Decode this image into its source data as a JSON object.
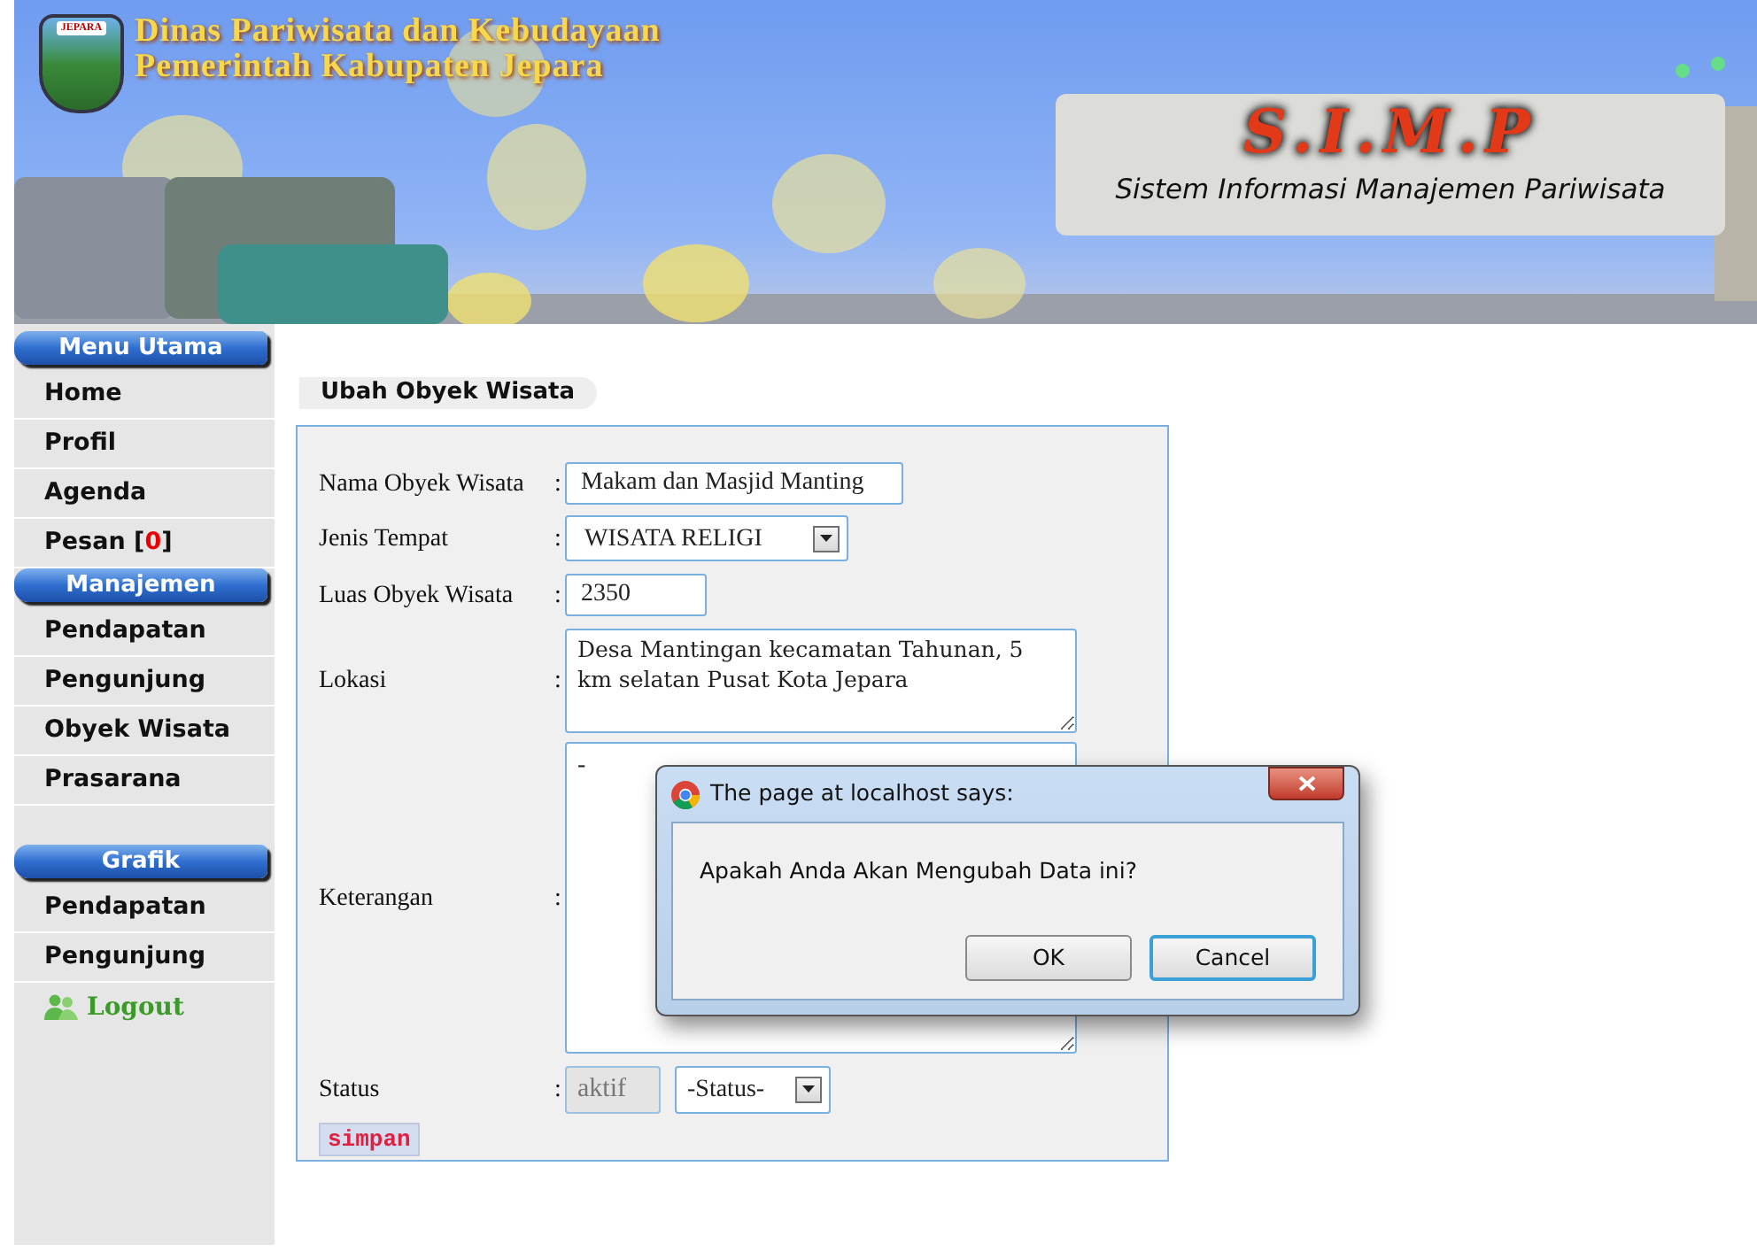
{
  "header": {
    "badge": "JEPARA",
    "agency_line_1": "Dinas Pariwisata dan Kebudayaan",
    "agency_line_2": "Pemerintah Kabupaten Jepara",
    "logo_title": "S.I.M.P",
    "subtitle": "Sistem Informasi Manajemen Pariwisata"
  },
  "sidebar": {
    "sections": [
      {
        "title": "Menu Utama",
        "items": [
          {
            "kind": "link",
            "label": "Home"
          },
          {
            "kind": "link",
            "label": "Profil"
          },
          {
            "kind": "link",
            "label": "Agenda"
          },
          {
            "kind": "count",
            "label": "Pesan [",
            "count": "0",
            "after": "]"
          }
        ]
      },
      {
        "title": "Manajemen",
        "items": [
          {
            "kind": "link",
            "label": "Pendapatan"
          },
          {
            "kind": "link",
            "label": "Pengunjung"
          },
          {
            "kind": "link",
            "label": "Obyek Wisata"
          },
          {
            "kind": "link",
            "label": "Prasarana"
          },
          {
            "kind": "spacer"
          }
        ]
      },
      {
        "title": "Grafik",
        "items": [
          {
            "kind": "link",
            "label": "Pendapatan"
          },
          {
            "kind": "link",
            "label": "Pengunjung"
          },
          {
            "kind": "logout",
            "label": "Logout"
          }
        ]
      }
    ]
  },
  "form": {
    "title": "Ubah Obyek Wisata",
    "fields": [
      {
        "kind": "text",
        "label": "Nama Obyek Wisata",
        "separator": ":",
        "value": "Makam dan Masjid Manting"
      },
      {
        "kind": "select",
        "label": "Jenis Tempat",
        "separator": ":",
        "value": "WISATA RELIGI"
      },
      {
        "kind": "number",
        "label": "Luas Obyek Wisata",
        "separator": ":",
        "value": "2350"
      },
      {
        "kind": "textarea",
        "label": "Lokasi",
        "separator": ":",
        "value": "Desa Mantingan kecamatan Tahunan, 5 km selatan Pusat Kota Jepara"
      },
      {
        "kind": "tall_textarea",
        "label": "Keterangan",
        "separator": ":",
        "value": "-"
      },
      {
        "kind": "status",
        "label": "Status",
        "separator": ":",
        "value": "aktif",
        "disabled": true,
        "option": "-Status-"
      }
    ],
    "submit": "simpan"
  },
  "dialog": {
    "title": "The page at localhost says:",
    "message": "Apakah Anda Akan Mengubah Data ini?",
    "buttons": [
      {
        "label": "OK",
        "focused": false
      },
      {
        "label": "Cancel",
        "focused": true
      }
    ]
  }
}
